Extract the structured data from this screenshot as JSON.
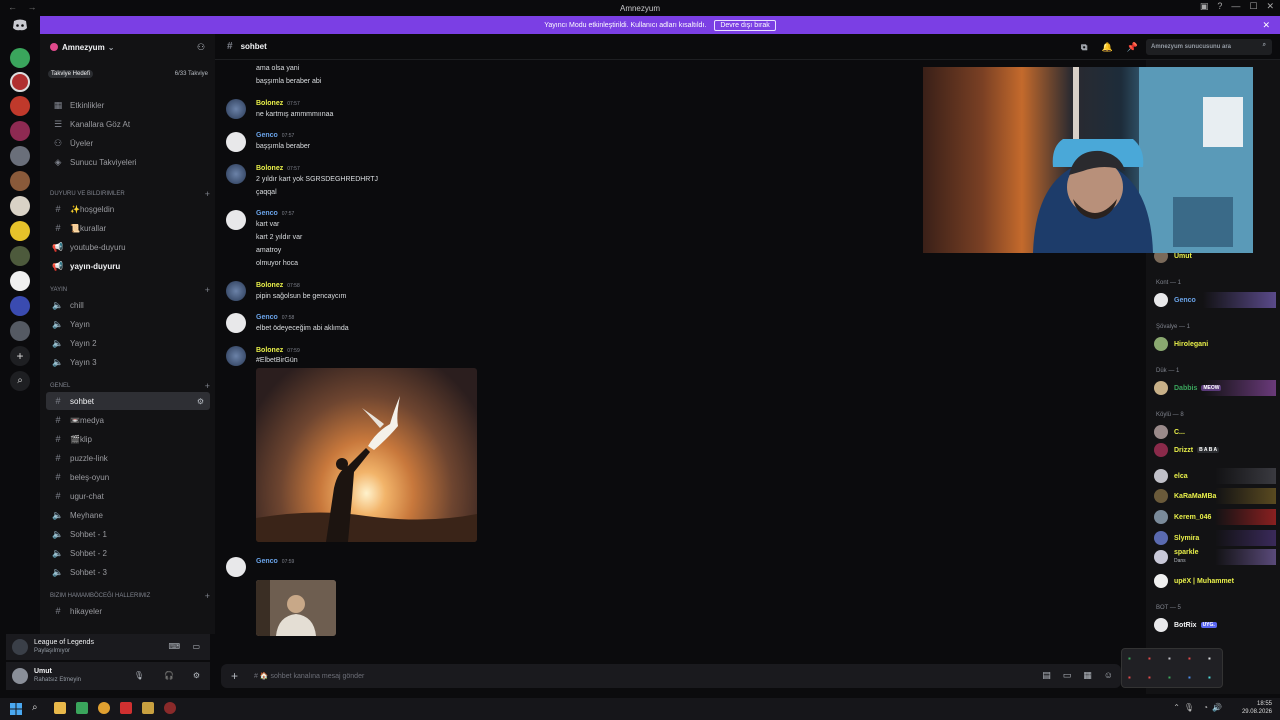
{
  "window": {
    "title": "Amnezyum"
  },
  "banner": {
    "text": "Yayıncı Modu etkinleştirildi. Kullanıcı adları kısaltıldı.",
    "button": "Devre dışı bırak"
  },
  "server": {
    "name": "Amnezyum",
    "boost_label": "Takviye Hedefi",
    "boost_count": "6/33 Takviye"
  },
  "sidebar": {
    "top_items": [
      "Etkinlikler",
      "Kanallara Göz At",
      "Üyeler",
      "Sunucu Takviyeleri"
    ],
    "categories": [
      {
        "name": "Duyuru ve Bildirimler",
        "channels": [
          "✨hoşgeldin",
          "📜kurallar",
          "youtube-duyuru",
          "yayın-duyuru"
        ]
      },
      {
        "name": "Yayın",
        "channels": [
          "chill",
          "Yayın",
          "Yayın 2",
          "Yayın 3"
        ]
      },
      {
        "name": "Genel",
        "channels": [
          "sohbet",
          "📼medya",
          "🎬klip",
          "puzzle-link",
          "beleş-oyun",
          "ugur-chat",
          "Meyhane",
          "Sohbet - 1",
          "Sohbet - 2",
          "Sohbet - 3"
        ]
      },
      {
        "name": "Bizim Hamamböceği Hallerimiz",
        "channels": [
          "hikayeler"
        ]
      }
    ]
  },
  "voice": {
    "game": "League of Legends",
    "status": "Paylaşılmıyor"
  },
  "user": {
    "name": "Umut",
    "status": "Rahatsız Etmeyin"
  },
  "channel": {
    "name": "sohbet",
    "search_placeholder": "Amnezyum sunucusunu ara"
  },
  "messages": [
    {
      "author": "",
      "time": "",
      "lines": [
        "ama olsa yani",
        "başşımla beraber abi"
      ]
    },
    {
      "author": "Bolonez",
      "time": "07:57",
      "lines": [
        "ne kartmış ammmmıınaa"
      ]
    },
    {
      "author": "Genco",
      "time": "07:57",
      "lines": [
        "başşımla beraber"
      ]
    },
    {
      "author": "Bolonez",
      "time": "07:57",
      "lines": [
        "2 yıldır kart yok SGRSDEGHREDHRTJ",
        "çaqqal"
      ]
    },
    {
      "author": "Genco",
      "time": "07:57",
      "lines": [
        "kart var",
        "kart 2 yıldır var",
        "amatroy",
        "olmuyor hoca"
      ]
    },
    {
      "author": "Bolonez",
      "time": "07:58",
      "lines": [
        "pipin sağolsun be gencaycım"
      ]
    },
    {
      "author": "Genco",
      "time": "07:58",
      "lines": [
        "elbet ödeyeceğim abi aklımda"
      ]
    },
    {
      "author": "Bolonez",
      "time": "07:59",
      "lines": [
        "#ElbetBirGün"
      ]
    },
    {
      "author": "Genco",
      "time": "07:59",
      "lines": []
    }
  ],
  "composer": {
    "placeholder": "# 🏠 sohbet kanalına mesaj gönder"
  },
  "members": {
    "top": "Umut",
    "groups": [
      {
        "title": "Kont — 1",
        "names": [
          "Genco"
        ]
      },
      {
        "title": "Şövalye — 1",
        "names": [
          "Hirolegani"
        ]
      },
      {
        "title": "Dük — 1",
        "names": [
          "Dabbis"
        ]
      },
      {
        "title": "Köylü — 8",
        "names": [
          "C...",
          "Drizzt",
          "elca",
          "KaRaMaMBa",
          "Kerem_046",
          "Slymira",
          "sparkle",
          "upëX | Muhammet"
        ]
      },
      {
        "title": "BOT — 5",
        "names": [
          "BotRix"
        ]
      }
    ],
    "tag_meow": "MEOW",
    "tag_baba": "B A B A",
    "tag_app": "UYG.",
    "sparkle_status": "Dans"
  },
  "clock": {
    "time": "18:55",
    "date": "29.08.2026"
  }
}
